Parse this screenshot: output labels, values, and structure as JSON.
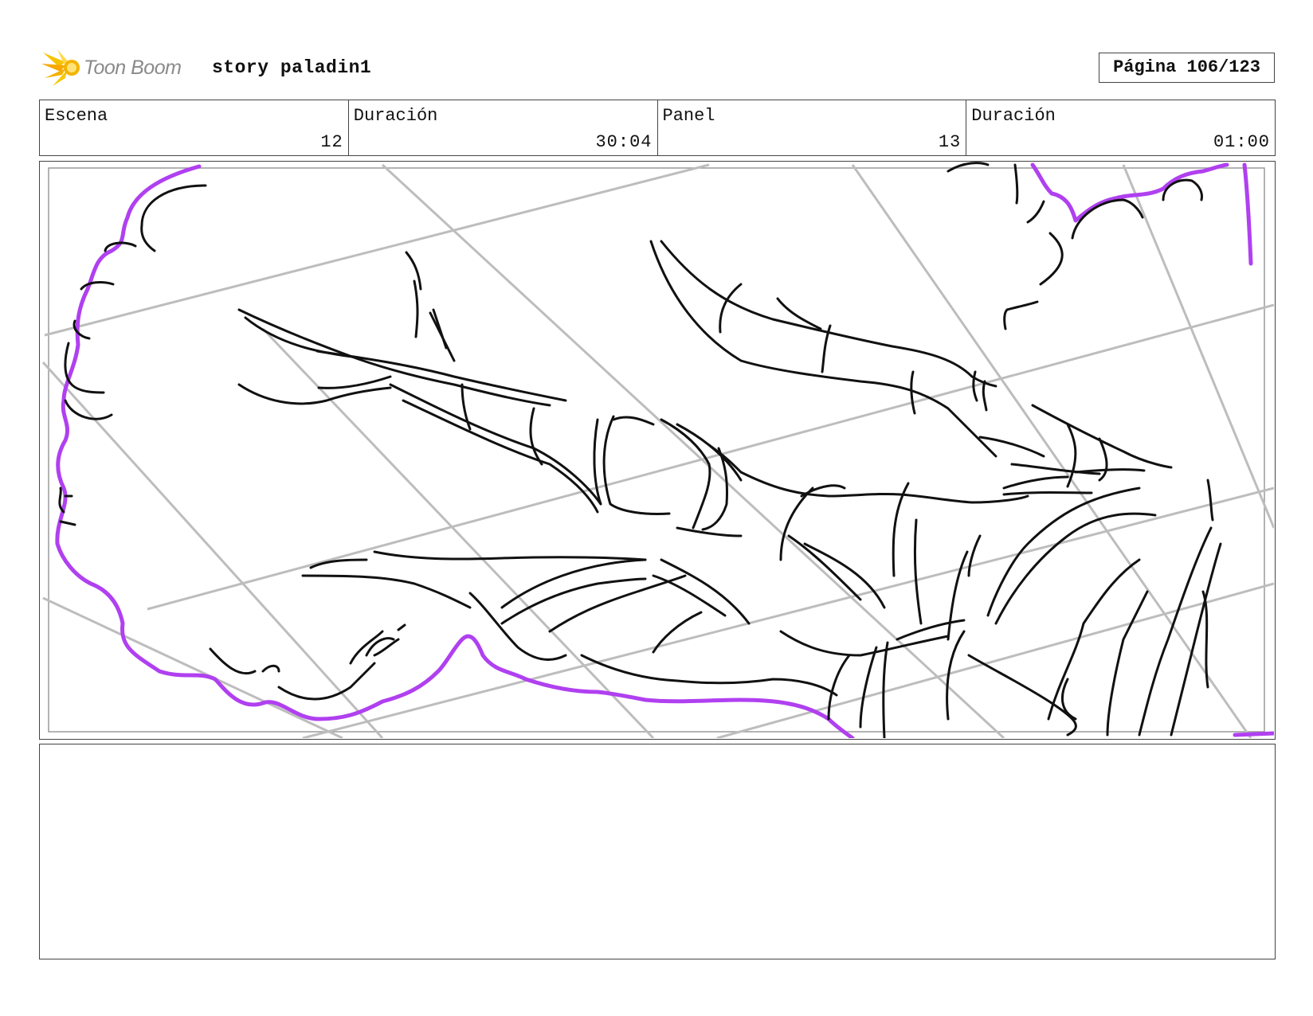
{
  "header": {
    "logo_text": "Toon Boom",
    "project_title": "story paladin1",
    "page_indicator": "Página 106/123"
  },
  "info_table": {
    "cells": [
      {
        "label": "Escena",
        "value": "12"
      },
      {
        "label": "Duración",
        "value": "30:04"
      },
      {
        "label": "Panel",
        "value": "13"
      },
      {
        "label": "Duración",
        "value": "01:00"
      }
    ]
  },
  "colors": {
    "border": "#444444",
    "sketch_ink": "#111111",
    "perspective_guides": "#bdbdbd",
    "smoke_outline": "#b040f0",
    "logo_star": "#f5b800",
    "logo_text": "#8a8a8a"
  },
  "notes": {
    "text": ""
  }
}
